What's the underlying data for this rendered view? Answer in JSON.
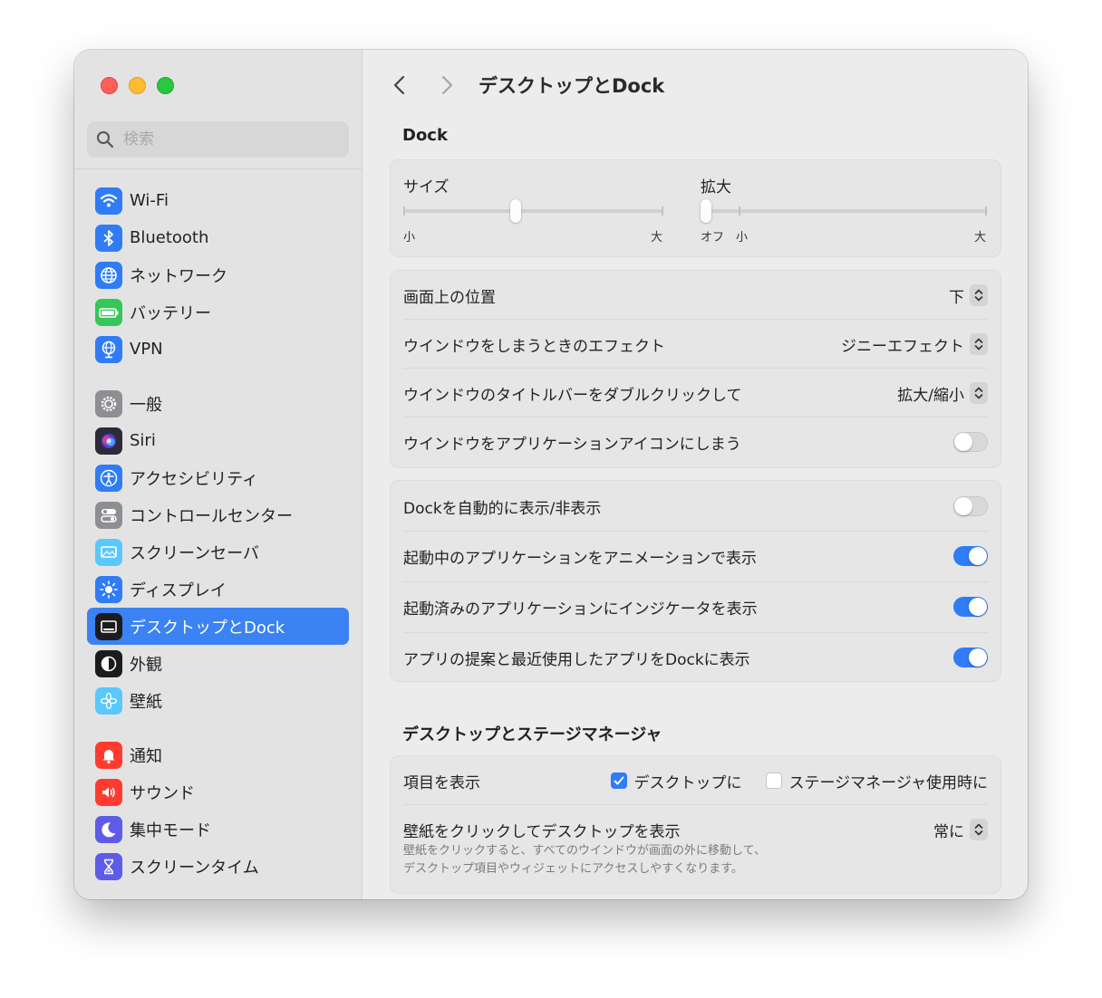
{
  "search": {
    "placeholder": "検索"
  },
  "sidebar": {
    "items": [
      {
        "label": "Wi-Fi",
        "icon": "wifi-icon",
        "color": "#2f7cf6"
      },
      {
        "label": "Bluetooth",
        "icon": "bluetooth-icon",
        "color": "#2f7cf6"
      },
      {
        "label": "ネットワーク",
        "icon": "globe-icon",
        "color": "#2f7cf6"
      },
      {
        "label": "バッテリー",
        "icon": "battery-icon",
        "color": "#34c759"
      },
      {
        "label": "VPN",
        "icon": "vpn-globe-icon",
        "color": "#2f7cf6"
      },
      {
        "label": "一般",
        "icon": "gear-icon",
        "color": "#8e8e93"
      },
      {
        "label": "Siri",
        "icon": "siri-icon",
        "color": "#2b2b3a"
      },
      {
        "label": "アクセシビリティ",
        "icon": "accessibility-icon",
        "color": "#2f7cf6"
      },
      {
        "label": "コントロールセンター",
        "icon": "control-center-icon",
        "color": "#8e8e93"
      },
      {
        "label": "スクリーンセーバ",
        "icon": "screensaver-icon",
        "color": "#5ac8fa"
      },
      {
        "label": "ディスプレイ",
        "icon": "sun-icon",
        "color": "#2f7cf6"
      },
      {
        "label": "デスクトップとDock",
        "icon": "dock-icon",
        "color": "#1c1c1e"
      },
      {
        "label": "外観",
        "icon": "appearance-icon",
        "color": "#1c1c1e"
      },
      {
        "label": "壁紙",
        "icon": "flower-icon",
        "color": "#5ac8fa"
      },
      {
        "label": "通知",
        "icon": "bell-icon",
        "color": "#ff3b30"
      },
      {
        "label": "サウンド",
        "icon": "speaker-icon",
        "color": "#ff3b30"
      },
      {
        "label": "集中モード",
        "icon": "moon-icon",
        "color": "#5e5ce6"
      },
      {
        "label": "スクリーンタイム",
        "icon": "hourglass-icon",
        "color": "#5e5ce6"
      }
    ],
    "active_index": 11
  },
  "header": {
    "title": "デスクトップとDock"
  },
  "dock": {
    "heading": "Dock",
    "size": {
      "label": "サイズ",
      "min_label": "小",
      "max_label": "大",
      "value": 0.43
    },
    "magnification": {
      "label": "拡大",
      "off_label": "オフ",
      "min_label": "小",
      "max_label": "大",
      "value": 0.0
    },
    "position": {
      "label": "画面上の位置",
      "value": "下"
    },
    "minimize_effect": {
      "label": "ウインドウをしまうときのエフェクト",
      "value": "ジニーエフェクト"
    },
    "double_click": {
      "label": "ウインドウのタイトルバーをダブルクリックして",
      "value": "拡大/縮小"
    },
    "minimize_into_icon": {
      "label": "ウインドウをアプリケーションアイコンにしまう",
      "on": false
    },
    "autohide": {
      "label": "Dockを自動的に表示/非表示",
      "on": false
    },
    "animate": {
      "label": "起動中のアプリケーションをアニメーションで表示",
      "on": true
    },
    "indicators": {
      "label": "起動済みのアプリケーションにインジケータを表示",
      "on": true
    },
    "suggested": {
      "label": "アプリの提案と最近使用したアプリをDockに表示",
      "on": true
    }
  },
  "stage": {
    "heading": "デスクトップとステージマネージャ",
    "show_items": {
      "label": "項目を表示",
      "desktop_label": "デスクトップに",
      "desktop_checked": true,
      "stage_label": "ステージマネージャ使用時に",
      "stage_checked": false
    },
    "click_wallpaper": {
      "label": "壁紙をクリックしてデスクトップを表示",
      "value": "常に",
      "desc_line1": "壁紙をクリックすると、すべてのウインドウが画面の外に移動して、",
      "desc_line2": "デスクトップ項目やウィジェットにアクセスしやすくなります。"
    }
  }
}
